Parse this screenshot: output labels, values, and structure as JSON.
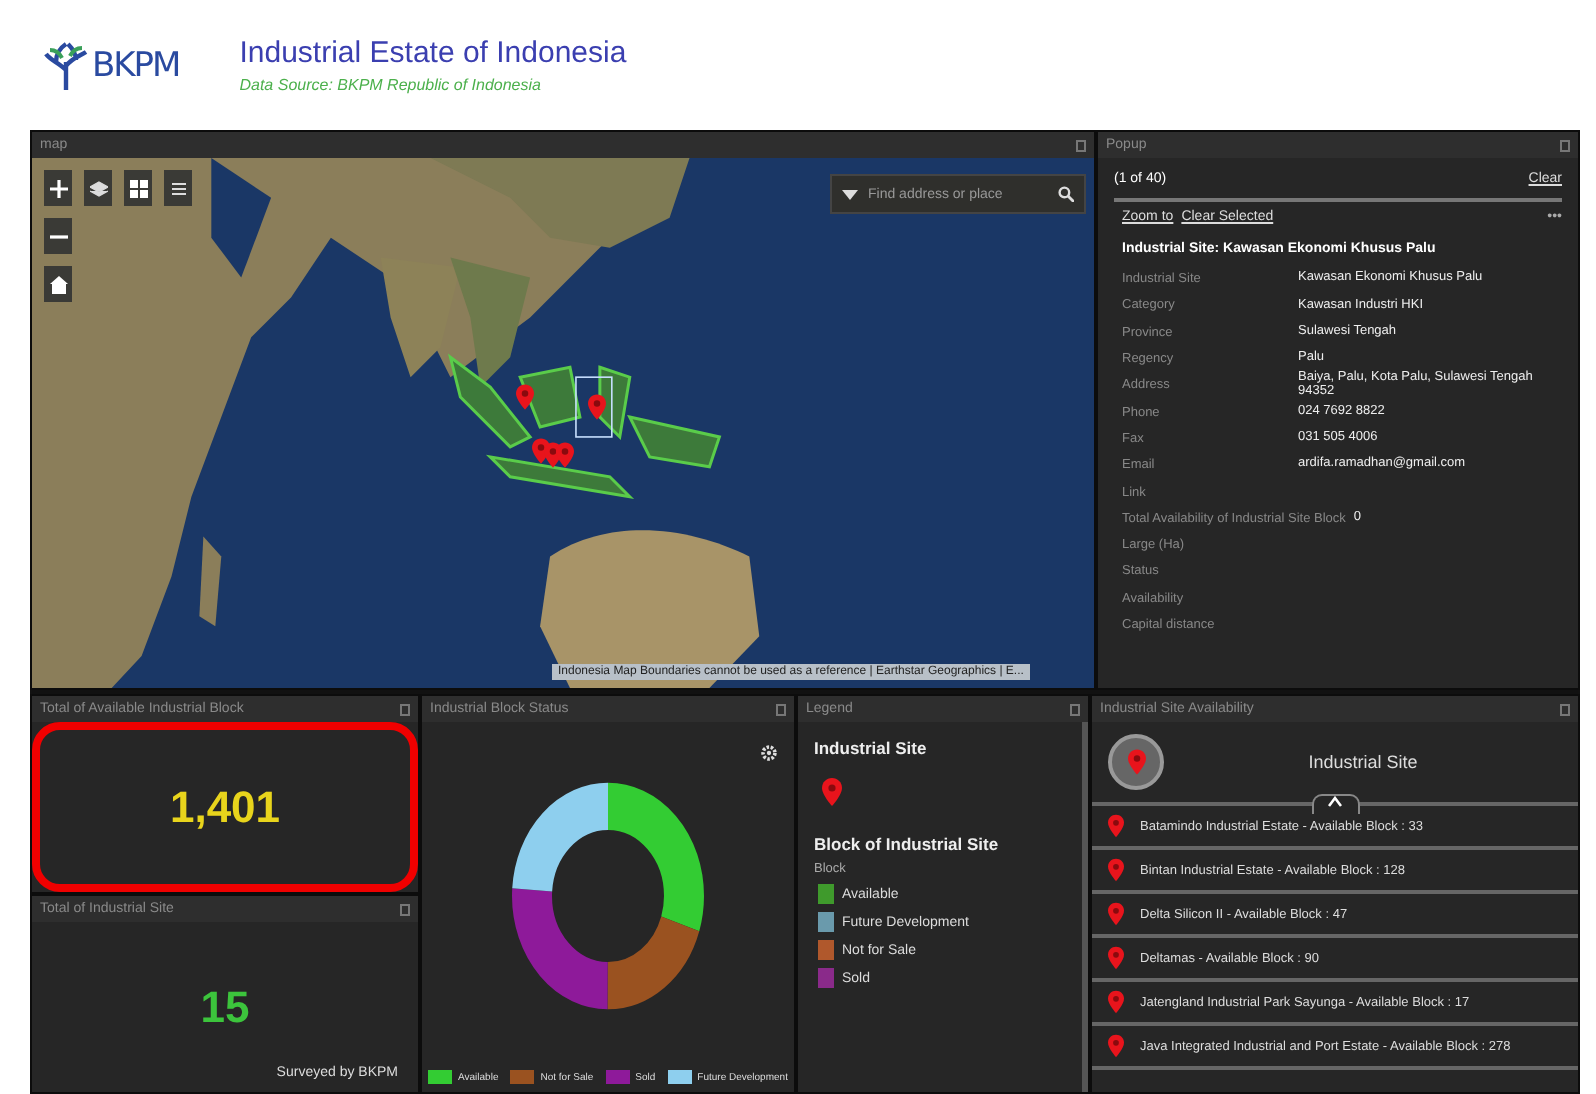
{
  "header": {
    "logo_text": "BKPM",
    "title": "Industrial Estate of Indonesia",
    "subtitle": "Data Source: BKPM Republic of Indonesia"
  },
  "map": {
    "title": "map",
    "search_placeholder": "Find address or place",
    "attribution": "Indonesia Map Boundaries cannot be used as a reference | Earthstar Geographics | E..."
  },
  "popup": {
    "title": "Popup",
    "counter": "(1 of 40)",
    "clear": "Clear",
    "actions": [
      "Zoom to",
      "Clear Selected"
    ],
    "more": "•••",
    "heading": "Industrial Site: Kawasan Ekonomi Khusus Palu",
    "fields": [
      {
        "label": "Industrial Site",
        "value": "Kawasan Ekonomi Khusus Palu"
      },
      {
        "label": "Category",
        "value": "Kawasan Industri HKI"
      },
      {
        "label": "Province",
        "value": "Sulawesi Tengah"
      },
      {
        "label": "Regency",
        "value": "Palu"
      },
      {
        "label": "Address",
        "value": "Baiya, Palu, Kota Palu, Sulawesi Tengah 94352"
      },
      {
        "label": "Phone",
        "value": "024 7692 8822"
      },
      {
        "label": "Fax",
        "value": "031 505 4006"
      },
      {
        "label": "Email",
        "value": "ardifa.ramadhan@gmail.com"
      },
      {
        "label": "Link"
      },
      {
        "label": "Total Availability of Industrial Site Block",
        "value": "0"
      },
      {
        "label": "Large (Ha)"
      },
      {
        "label": "Status"
      },
      {
        "label": "Availability"
      },
      {
        "label": "Capital distance"
      }
    ]
  },
  "kpis": [
    {
      "title": "Total of Available Industrial Block",
      "value": "1,401",
      "color": "#e8d41c",
      "highlighted": true
    },
    {
      "title": "Total of Industrial Site",
      "value": "15",
      "color": "#3cc43c",
      "footnote": "Surveyed by BKPM",
      "highlighted": false
    }
  ],
  "block_status": {
    "title": "Industrial Block Status",
    "legend": [
      {
        "label": "Available",
        "color": "#33cc33"
      },
      {
        "label": "Not for Sale",
        "color": "#9a5220"
      },
      {
        "label": "Sold",
        "color": "#8e1a9a"
      },
      {
        "label": "Future Development",
        "color": "#8ecfee"
      }
    ]
  },
  "legend": {
    "title": "Legend",
    "site_heading": "Industrial Site",
    "block_heading": "Block of Industrial Site",
    "block_label": "Block",
    "items": [
      {
        "label": "Available",
        "color": "#3f9a2c"
      },
      {
        "label": "Future Development",
        "color": "#6a9aac"
      },
      {
        "label": "Not for Sale",
        "color": "#b0582c"
      },
      {
        "label": "Sold",
        "color": "#8a2a8a"
      }
    ]
  },
  "availability": {
    "title": "Industrial Site Availability",
    "heading": "Industrial Site",
    "items": [
      "Batamindo Industrial Estate - Available Block : 33",
      "Bintan Industrial Estate - Available Block : 128",
      "Delta Silicon II - Available Block : 47",
      "Deltamas - Available Block : 90",
      "Jatengland Industrial Park Sayunga - Available Block : 17",
      "Java Integrated Industrial and Port Estate - Available Block : 278"
    ]
  }
}
